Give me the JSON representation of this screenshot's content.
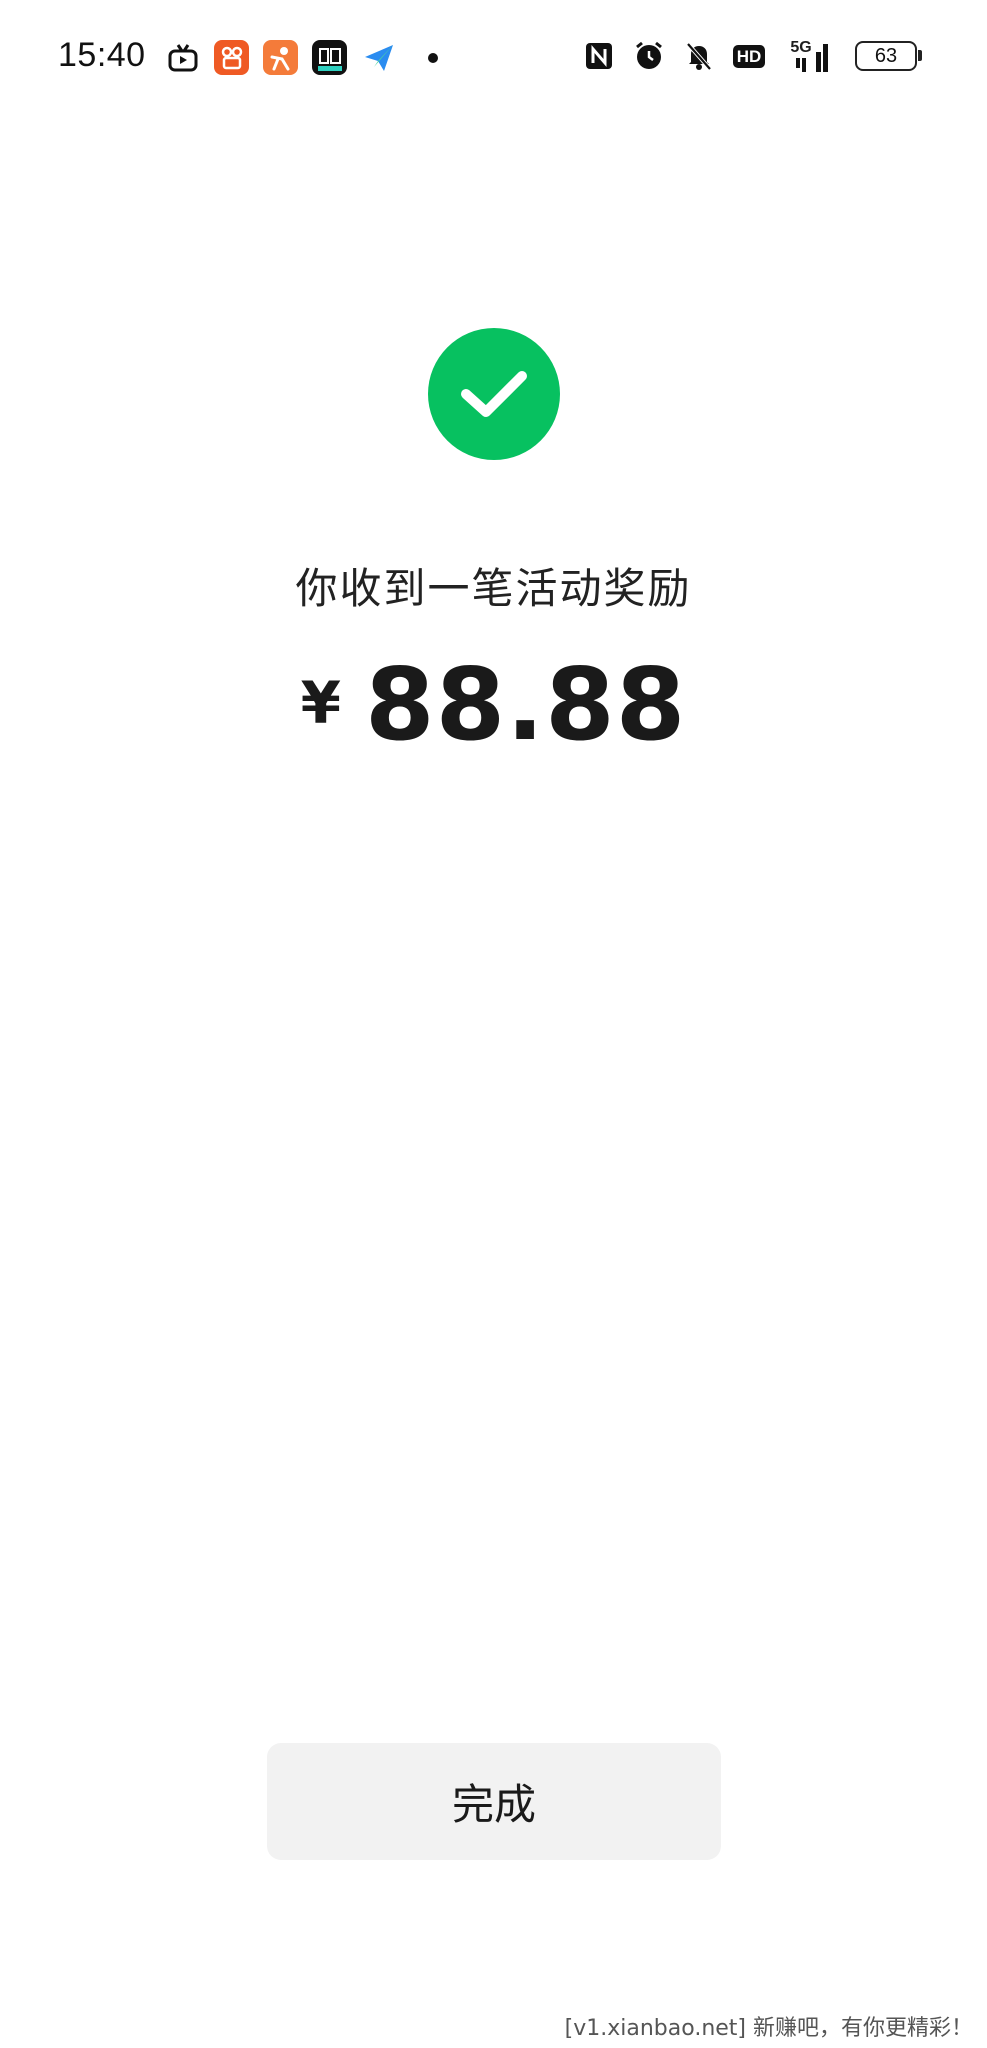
{
  "status_bar": {
    "time": "15:40",
    "app_icons": [
      "tv-app-icon",
      "kuaishou-icon",
      "dianping-icon",
      "qianniu-icon",
      "paper-plane-icon"
    ],
    "network": "5G",
    "hd_label": "HD",
    "battery": "63"
  },
  "main": {
    "title": "你收到一笔活动奖励",
    "currency": "¥",
    "amount": "88.88",
    "success_color": "#07C160"
  },
  "actions": {
    "done_label": "完成"
  },
  "watermark": "[v1.xianbao.net] 新赚吧，有你更精彩！"
}
